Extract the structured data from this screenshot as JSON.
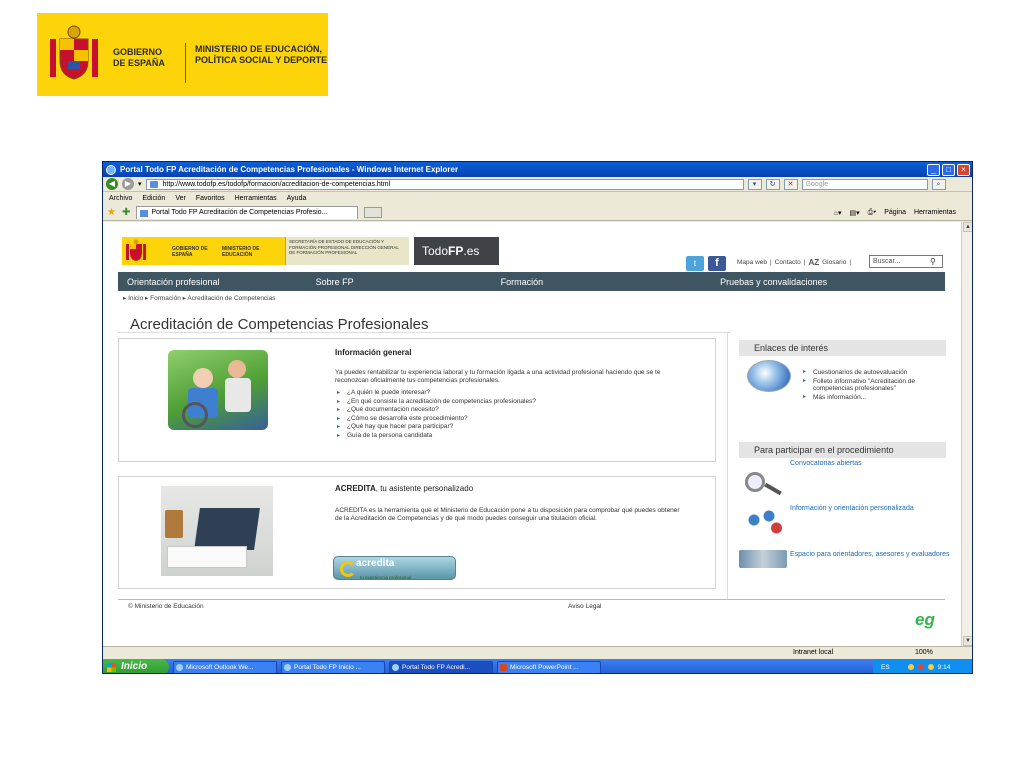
{
  "gov_banner": {
    "line1": "GOBIERNO DE ESPAÑA",
    "line2": "MINISTERIO DE EDUCACIÓN, POLÍTICA SOCIAL Y DEPORTE"
  },
  "window": {
    "title": "Portal Todo FP Acreditación de Competencias Profesionales - Windows Internet Explorer",
    "buttons": {
      "minimize": "_",
      "maximize": "□",
      "close": "×"
    }
  },
  "browser": {
    "address": "http://www.todofp.es/todofp/formacion/acreditacion-de-competencias.html",
    "search_placeholder": "Google",
    "menu": [
      "Archivo",
      "Edición",
      "Ver",
      "Favoritos",
      "Herramientas",
      "Ayuda"
    ],
    "tab_label": "Portal Todo FP Acreditación de Competencias Profesio...",
    "commands": {
      "page": "Página",
      "tools": "Herramientas"
    }
  },
  "site": {
    "logo_gov": "GOBIERNO DE ESPAÑA",
    "logo_ministry": "MINISTERIO DE EDUCACIÓN",
    "logo_sub": "SECRETARÍA DE ESTADO DE EDUCACIÓN Y FORMACIÓN PROFESIONAL DIRECCIÓN GENERAL DE FORMACIÓN PROFESIONAL",
    "brand_a": "Todo",
    "brand_b": "FP",
    "brand_c": ".es",
    "top_links": [
      "Mapa web",
      "Contacto",
      "Glosario"
    ],
    "az": "AZ",
    "search_placeholder": "Buscar...",
    "nav": [
      "Orientación profesional",
      "Sobre FP",
      "Formación",
      "Pruebas y convalidaciones"
    ],
    "breadcrumb": "▸ Inicio ▸ Formación ▸ Acreditación de Competencias",
    "page_title": "Acreditación de Competencias Profesionales",
    "info": {
      "title": "Información general",
      "text": "Ya puedes rentabilizar tu experiencia laboral y tu formación ligada a una actividad profesional haciendo que se te reconozcan oficialmente tus competencias profesionales.",
      "questions": [
        "¿A quién le puede interesar?",
        "¿En qué consiste la acreditación de competencias profesionales?",
        "¿Qué documentación necesito?",
        "¿Cómo se desarrolla este procedimiento?",
        "¿Qué hay que hacer para participar?",
        "Guía de la persona candidata"
      ]
    },
    "acredita": {
      "title_bold": "ACREDITA",
      "title_rest": ", tu asistente personalizado",
      "text": "ACREDITA es la herramienta que el Ministerio de Educación pone a tu disposición para comprobar qué puedes obtener de la Acreditación de Competencias y de qué modo puedes conseguir una titulación oficial.",
      "button_main": "acredita",
      "button_sub": "tu experiencia profesional"
    },
    "sidebar": {
      "links_title": "Enlaces de interés",
      "links": [
        "Cuestionarios de autoevaluación",
        "Folleto informativo \"Acreditación de competencias profesionales\"",
        "Más información..."
      ],
      "participate_title": "Para participar en el procedimiento",
      "participate": [
        "Convocatorias abiertas",
        "Información y orientación personalizada",
        "Espacio para orientadores, asesores y evaluadores"
      ]
    },
    "footer": {
      "copyright": "© Ministerio de Educación",
      "legal": "Aviso Legal",
      "logo": "eg"
    }
  },
  "statusbar": {
    "zone": "Intranet local",
    "zoom": "100%"
  },
  "taskbar": {
    "start": "Inicio",
    "tasks": [
      "Microsoft Outlook We...",
      "Portal Todo FP Inicio ...",
      "Portal Todo FP Acredi...",
      "Microsoft PowerPoint ..."
    ],
    "lang": "ES",
    "clock": "9:14"
  }
}
